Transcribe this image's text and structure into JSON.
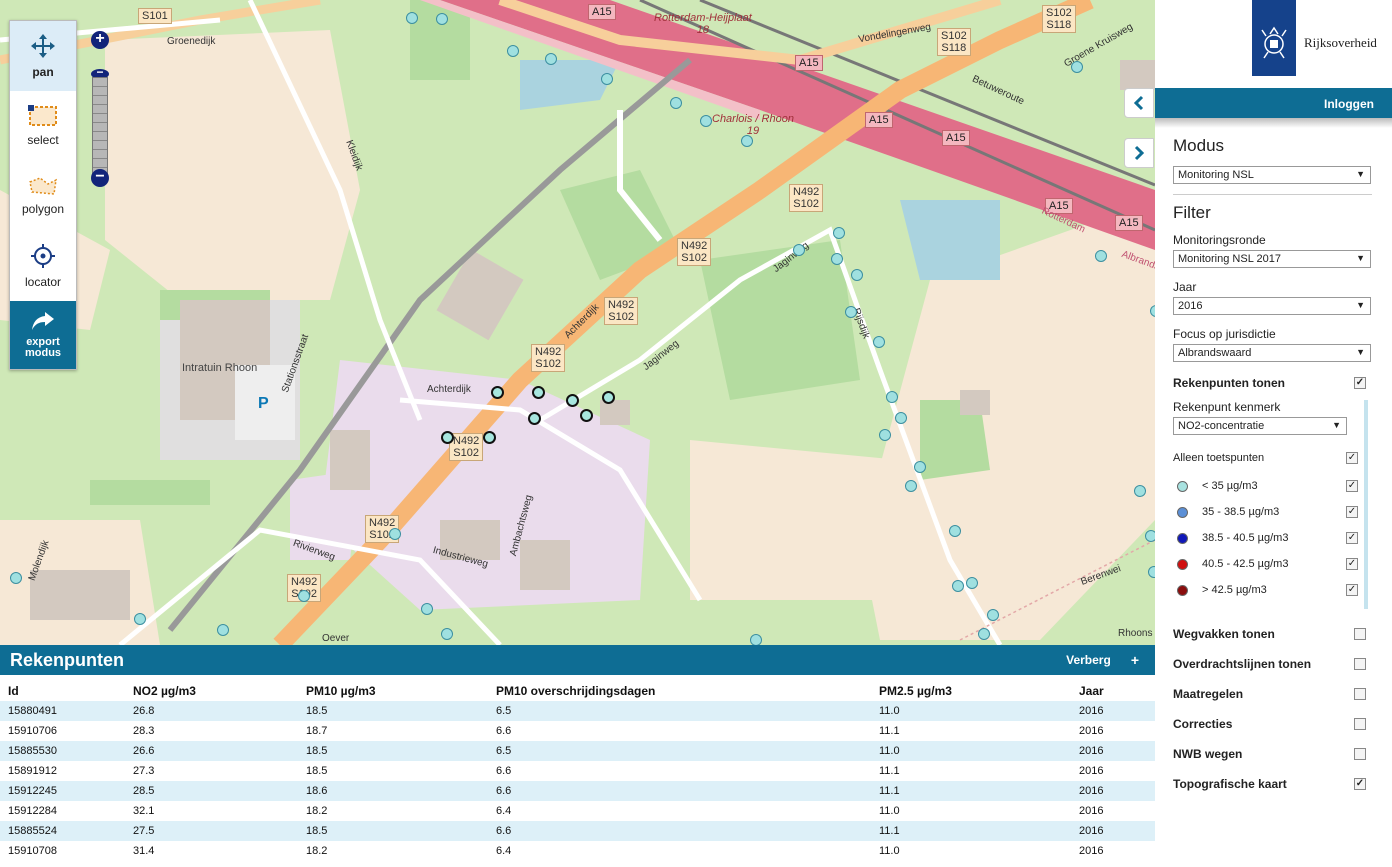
{
  "map": {
    "toolbar": {
      "pan": "pan",
      "select": "select",
      "polygon": "polygon",
      "locator": "locator",
      "export_line1": "export",
      "export_line2": "modus"
    },
    "zoom": {
      "in": "+",
      "out": "−"
    },
    "road_labels": {
      "s101": "S101",
      "n492a_1": "N492",
      "n492a_2": "S102",
      "n492b_1": "N492",
      "n492b_2": "S102",
      "n492c_1": "N492",
      "n492c_2": "S102",
      "n492d_1": "N492",
      "n492d_2": "S102",
      "n492e_1": "N492",
      "n492e_2": "S102",
      "n492f_1": "N492",
      "n492f_2": "S102",
      "n492g_1": "N492",
      "n492g_2": "S102",
      "s102s118_1": "S102",
      "s102s118_2": "S118",
      "s102s118b_1": "S102",
      "s102s118b_2": "S118",
      "a15_1": "A15",
      "a15_2": "A15",
      "a15_3": "A15",
      "a15_4": "A15",
      "a15_5": "A15",
      "a15_6": "A15"
    },
    "streets": {
      "groenedijk": "Groenedijk",
      "kleidijk": "Kleidijk",
      "achterdijk1": "Achterdijk",
      "achterdijk2": "Achterdijk",
      "jaginweg1": "Jaginweg",
      "jaginweg2": "Jaginweg",
      "rijsdijk": "Rijsdijk",
      "stationsstraat": "Stationsstraat",
      "rivierweg": "Rivierweg",
      "industrieweg": "Industrieweg",
      "ambachtsweg": "Ambachtsweg",
      "vondelingenweg": "Vondelingenweg",
      "groenekruisweg": "Groene Kruisweg",
      "betuweroute": "Betuweroute",
      "berenwei": "Berenwei",
      "rhoons": "Rhoons",
      "oever": "Oever",
      "molendijk": "Molendijk",
      "albrandswaard": "Albrandswaard",
      "rotterdam": "Rotterdam"
    },
    "places": {
      "intratuin": "Intratuin Rhoon",
      "parking": "P",
      "heijplaat": "Rotterdam-Heijplaat",
      "heijplaat_num": "18",
      "charlois": "Charlois / Rhoon",
      "charlois_num": "19"
    }
  },
  "panel": {
    "title": "Rekenpunten",
    "hide": "Verberg",
    "add": "+",
    "columns": [
      "Id",
      "NO2 µg/m3",
      "PM10 µg/m3",
      "PM10 overschrijdingsdagen",
      "PM2.5 µg/m3",
      "Jaar"
    ],
    "rows": [
      [
        "15880491",
        "26.8",
        "18.5",
        "6.5",
        "11.0",
        "2016"
      ],
      [
        "15910706",
        "28.3",
        "18.7",
        "6.6",
        "11.1",
        "2016"
      ],
      [
        "15885530",
        "26.6",
        "18.5",
        "6.5",
        "11.0",
        "2016"
      ],
      [
        "15891912",
        "27.3",
        "18.5",
        "6.6",
        "11.1",
        "2016"
      ],
      [
        "15912245",
        "28.5",
        "18.6",
        "6.6",
        "11.1",
        "2016"
      ],
      [
        "15912284",
        "32.1",
        "18.2",
        "6.4",
        "11.0",
        "2016"
      ],
      [
        "15885524",
        "27.5",
        "18.5",
        "6.6",
        "11.1",
        "2016"
      ],
      [
        "15910708",
        "31.4",
        "18.2",
        "6.4",
        "11.0",
        "2016"
      ]
    ]
  },
  "side": {
    "logo_text": "Rijksoverheid",
    "login": "Inloggen",
    "modus_title": "Modus",
    "modus_value": "Monitoring NSL",
    "filter_title": "Filter",
    "ronde_label": "Monitoringsronde",
    "ronde_value": "Monitoring NSL 2017",
    "jaar_label": "Jaar",
    "jaar_value": "2016",
    "focus_label": "Focus op jurisdictie",
    "focus_value": "Albrandswaard",
    "rekenpunten_tonen": "Rekenpunten tonen",
    "kenmerk_label": "Rekenpunt kenmerk",
    "kenmerk_value": "NO2-concentratie",
    "alleen_toets": "Alleen toetspunten",
    "legend": [
      {
        "label": "< 35 µg/m3",
        "color": "#a8e2e0"
      },
      {
        "label": "35 - 38.5 µg/m3",
        "color": "#5b8fd6"
      },
      {
        "label": "38.5 - 40.5 µg/m3",
        "color": "#1018b8"
      },
      {
        "label": "40.5 - 42.5 µg/m3",
        "color": "#d01010"
      },
      {
        "label": "> 42.5 µg/m3",
        "color": "#8a0d0d"
      }
    ],
    "layers": [
      {
        "label": "Wegvakken tonen",
        "checked": false
      },
      {
        "label": "Overdrachtslijnen tonen",
        "checked": false
      },
      {
        "label": "Maatregelen",
        "checked": false
      },
      {
        "label": "Correcties",
        "checked": false
      },
      {
        "label": "NWB wegen",
        "checked": false
      },
      {
        "label": "Topografische kaart",
        "checked": true
      }
    ],
    "check_mark": "✓"
  },
  "colors": {
    "accent": "#0e6d94",
    "zoom": "#12247a",
    "logo": "#15428b"
  }
}
